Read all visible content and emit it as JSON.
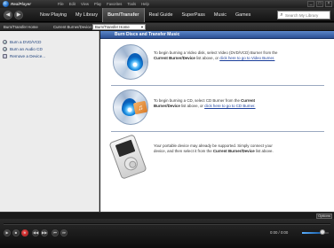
{
  "app": {
    "logo_text": "RealPlayer"
  },
  "menu": [
    "File",
    "Edit",
    "View",
    "Play",
    "Favorites",
    "Tools",
    "Help"
  ],
  "window_controls": [
    "_",
    "□",
    "×"
  ],
  "nav": {
    "back_glyph": "◀",
    "forward_glyph": "▶",
    "tabs": [
      "Now Playing",
      "My Library",
      "Burn/Transfer",
      "Real Guide",
      "SuperPass",
      "Music",
      "Games"
    ],
    "active_tab": "Burn/Transfer",
    "search_placeholder": "Search My Library"
  },
  "toolbar": {
    "crumb_label": "Burn/Transfer Home",
    "device_label": "Current Burner/Device:",
    "device_value": "Burn/Transfer Home"
  },
  "sidebar": {
    "items": [
      {
        "label": "Burn a DVD/VCD",
        "icon": "disc-icon"
      },
      {
        "label": "Burn an Audio CD",
        "icon": "disc-icon"
      },
      {
        "label": "Remove a Device...",
        "icon": "device-icon"
      }
    ]
  },
  "main": {
    "header": "Burn Discs and Transfer Music",
    "sections": [
      {
        "icon": "video-disc-icon",
        "before": "To begin burning a Video disk, select Video (DVD/VCD) Burner from the ",
        "bold": "Current Burner/Device",
        "middle": " list above, or ",
        "link": "click here to go to Video Burner.",
        "after": ""
      },
      {
        "icon": "audio-cd-icon",
        "before": "To begin burning a CD, select CD Burner from the ",
        "bold": "Current Burner/Device",
        "middle": " list above, or ",
        "link": "click here to go to CD Burner.",
        "after": ""
      },
      {
        "icon": "portable-device-icon",
        "before": "Your portable device may already be supported. Simply connect your device, and then select it from the ",
        "bold": "Current Burner/Device",
        "middle": " list above.",
        "link": "",
        "after": ""
      }
    ]
  },
  "status": {
    "options_label": "Options"
  },
  "player": {
    "buttons": [
      "▶",
      "■",
      "●",
      "◀◀",
      "▶▶",
      "⏮",
      "⏭"
    ],
    "time": "0:00 / 0:00"
  },
  "colors": {
    "accent": "#2a4e93",
    "link": "#1a3e9a",
    "sidebar_bg": "#ececec"
  }
}
